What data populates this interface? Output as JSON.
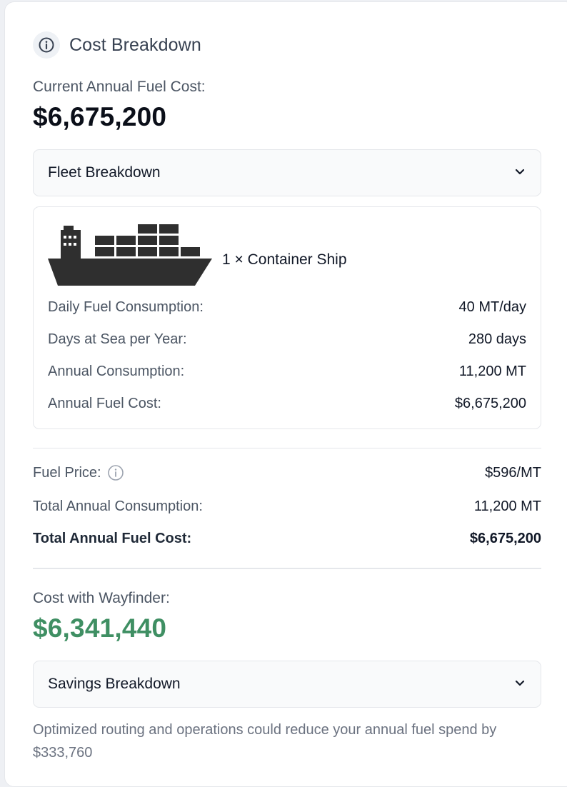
{
  "header": {
    "title": "Cost Breakdown"
  },
  "current": {
    "label": "Current Annual Fuel Cost:",
    "value": "$6,675,200"
  },
  "fleet_accordion": {
    "label": "Fleet Breakdown"
  },
  "ship": {
    "title": "1 × Container Ship",
    "rows": [
      {
        "label": "Daily Fuel Consumption:",
        "value": "40 MT/day"
      },
      {
        "label": "Days at Sea per Year:",
        "value": "280 days"
      },
      {
        "label": "Annual Consumption:",
        "value": "11,200 MT"
      },
      {
        "label": "Annual Fuel Cost:",
        "value": "$6,675,200"
      }
    ]
  },
  "summary": {
    "fuel_price_label": "Fuel Price:",
    "fuel_price_value": "$596/MT",
    "total_consumption_label": "Total Annual Consumption:",
    "total_consumption_value": "11,200 MT",
    "total_cost_label": "Total Annual Fuel Cost:",
    "total_cost_value": "$6,675,200"
  },
  "wayfinder": {
    "label": "Cost with Wayfinder:",
    "value": "$6,341,440"
  },
  "savings_accordion": {
    "label": "Savings Breakdown"
  },
  "note": "Optimized routing and operations could reduce your annual fuel spend by $333,760",
  "icons": {
    "header": "info-icon",
    "fuel_price": "info-icon",
    "ship": "container-ship-icon",
    "accordion": "chevron-down-icon"
  },
  "colors": {
    "savings_green": "#3f8f63",
    "primary_text": "#0b0f19",
    "muted_text": "#4b5563"
  }
}
